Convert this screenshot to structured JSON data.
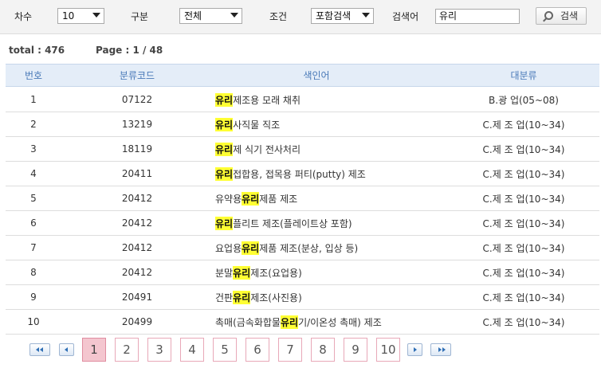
{
  "search": {
    "degree_label": "차수",
    "degree_value": "10",
    "category_label": "구분",
    "category_value": "전체",
    "condition_label": "조건",
    "condition_value": "포함검색",
    "keyword_label": "검색어",
    "keyword_value": "유리",
    "search_button": "검색"
  },
  "summary": {
    "total": "total : 476",
    "page": "Page : 1 / 48"
  },
  "table": {
    "headers": [
      "번호",
      "분류코드",
      "색인어",
      "대분류"
    ],
    "rows": [
      {
        "no": "1",
        "code": "07122",
        "pre": "",
        "hl": "유리",
        "post": " 제조용 모래 채취",
        "cat": "B.광 업(05~08)"
      },
      {
        "no": "2",
        "code": "13219",
        "pre": "",
        "hl": "유리",
        "post": "사직물 직조",
        "cat": "C.제 조 업(10~34)"
      },
      {
        "no": "3",
        "code": "18119",
        "pre": "",
        "hl": "유리",
        "post": "제 식기 전사처리",
        "cat": "C.제 조 업(10~34)"
      },
      {
        "no": "4",
        "code": "20411",
        "pre": "",
        "hl": "유리",
        "post": "접합용, 접목용 퍼티(putty) 제조",
        "cat": "C.제 조 업(10~34)"
      },
      {
        "no": "5",
        "code": "20412",
        "pre": "유약용 ",
        "hl": "유리",
        "post": "제품 제조",
        "cat": "C.제 조 업(10~34)"
      },
      {
        "no": "6",
        "code": "20412",
        "pre": "",
        "hl": "유리",
        "post": "플리트 제조(플레이트상 포함)",
        "cat": "C.제 조 업(10~34)"
      },
      {
        "no": "7",
        "code": "20412",
        "pre": "요업용 ",
        "hl": "유리",
        "post": "제품 제조(분상, 입상 등)",
        "cat": "C.제 조 업(10~34)"
      },
      {
        "no": "8",
        "code": "20412",
        "pre": "분말",
        "hl": "유리",
        "post": " 제조(요업용)",
        "cat": "C.제 조 업(10~34)"
      },
      {
        "no": "9",
        "code": "20491",
        "pre": "건판",
        "hl": "유리",
        "post": " 제조(사진용)",
        "cat": "C.제 조 업(10~34)"
      },
      {
        "no": "10",
        "code": "20499",
        "pre": "촉매(금속화합물 ",
        "hl": "유리",
        "post": "기/이온성 촉매) 제조",
        "cat": "C.제 조 업(10~34)"
      }
    ]
  },
  "pager": {
    "pages": [
      "1",
      "2",
      "3",
      "4",
      "5",
      "6",
      "7",
      "8",
      "9",
      "10"
    ],
    "current": "1"
  },
  "colors": {
    "highlight": "#ffff33",
    "header_bg": "#e4edf8",
    "header_text": "#4a7ab8",
    "active_page": "#f4c6cf"
  }
}
